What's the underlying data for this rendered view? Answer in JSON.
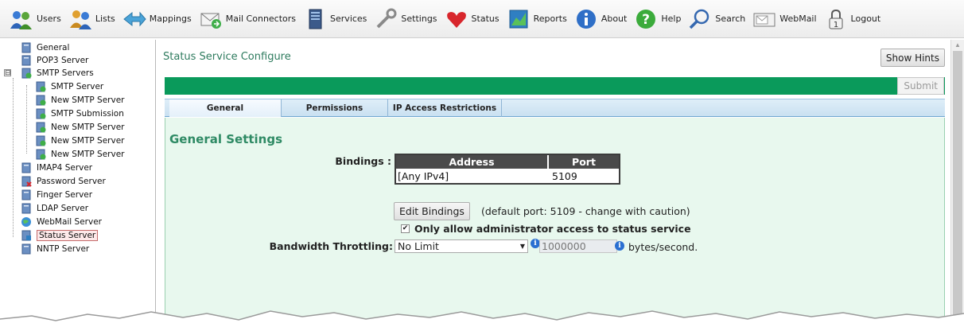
{
  "toolbar": {
    "items": [
      {
        "label": "Users",
        "icon": "users-icon"
      },
      {
        "label": "Lists",
        "icon": "lists-icon"
      },
      {
        "label": "Mappings",
        "icon": "mappings-icon"
      },
      {
        "label": "Mail Connectors",
        "icon": "mail-connectors-icon"
      },
      {
        "label": "Services",
        "icon": "services-icon"
      },
      {
        "label": "Settings",
        "icon": "settings-icon"
      },
      {
        "label": "Status",
        "icon": "status-icon"
      },
      {
        "label": "Reports",
        "icon": "reports-icon"
      },
      {
        "label": "About",
        "icon": "about-icon"
      },
      {
        "label": "Help",
        "icon": "help-icon"
      },
      {
        "label": "Search",
        "icon": "search-icon"
      },
      {
        "label": "WebMail",
        "icon": "webmail-icon"
      },
      {
        "label": "Logout",
        "icon": "logout-icon"
      }
    ]
  },
  "tree": {
    "items": [
      {
        "label": "General",
        "icon": "server-icon"
      },
      {
        "label": "POP3 Server",
        "icon": "server-icon"
      },
      {
        "label": "SMTP Servers",
        "icon": "smtp-group-icon",
        "expander": "⊟"
      },
      {
        "label": "SMTP Server",
        "icon": "smtp-server-icon"
      },
      {
        "label": "New SMTP Server",
        "icon": "smtp-server-icon"
      },
      {
        "label": "SMTP Submission",
        "icon": "smtp-server-icon"
      },
      {
        "label": "New SMTP Server",
        "icon": "smtp-server-icon"
      },
      {
        "label": "New SMTP Server",
        "icon": "smtp-server-icon"
      },
      {
        "label": "New SMTP Server",
        "icon": "smtp-server-icon"
      },
      {
        "label": "IMAP4 Server",
        "icon": "server-icon"
      },
      {
        "label": "Password Server",
        "icon": "password-server-icon"
      },
      {
        "label": "Finger Server",
        "icon": "server-icon"
      },
      {
        "label": "LDAP Server",
        "icon": "server-icon"
      },
      {
        "label": "WebMail Server",
        "icon": "webmail-server-icon"
      },
      {
        "label": "Status Server",
        "icon": "status-server-icon",
        "selected": true
      },
      {
        "label": "NNTP Server",
        "icon": "server-icon"
      }
    ]
  },
  "main": {
    "title": "Status Service Configure",
    "show_hints_label": "Show Hints",
    "submit_label": "Submit",
    "tabs": [
      {
        "label": "General",
        "active": true
      },
      {
        "label": "Permissions",
        "active": false
      },
      {
        "label": "IP Access Restrictions",
        "active": false
      }
    ],
    "section_title": "General Settings",
    "bindings_label": "Bindings :",
    "bindings": {
      "headers": [
        "Address",
        "Port"
      ],
      "rows": [
        [
          "[Any IPv4]",
          "5109"
        ]
      ]
    },
    "edit_bindings_label": "Edit Bindings",
    "edit_bindings_note": "(default port: 5109 - change with caution)",
    "admin_only_label": "Only allow administrator access to status service",
    "admin_only_checked": true,
    "bandwidth_label": "Bandwidth Throttling:",
    "bandwidth_select_value": "No Limit",
    "bandwidth_value": "1000000",
    "bandwidth_unit": "bytes/second."
  },
  "colors": {
    "accent_green": "#0a9a5b",
    "title_green": "#2e7b5e",
    "content_bg": "#e8f8ee",
    "tab_blue": "#c9e0f1"
  }
}
